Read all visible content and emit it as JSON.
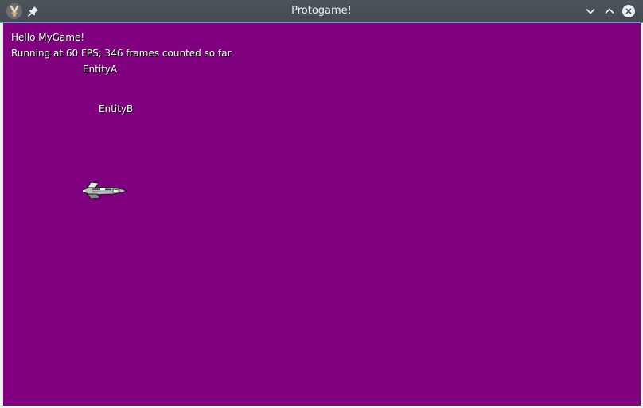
{
  "window": {
    "title": "Protogame!",
    "accent_color": "#3daee9",
    "titlebar_color": "#4d5459"
  },
  "titlebar": {
    "app_icon": "app-icon",
    "pin_icon": "pin-icon",
    "minimize_icon": "chevron-down-icon",
    "maximize_icon": "chevron-up-icon",
    "close_icon": "close-icon"
  },
  "game": {
    "background_color": "#800080",
    "hud": {
      "hello": "Hello MyGame!",
      "fps_text": "Running at 60 FPS; 346 frames counted so far"
    },
    "entities": [
      {
        "label": "EntityA"
      },
      {
        "label": "EntityB"
      }
    ],
    "sprite": "spaceship"
  }
}
